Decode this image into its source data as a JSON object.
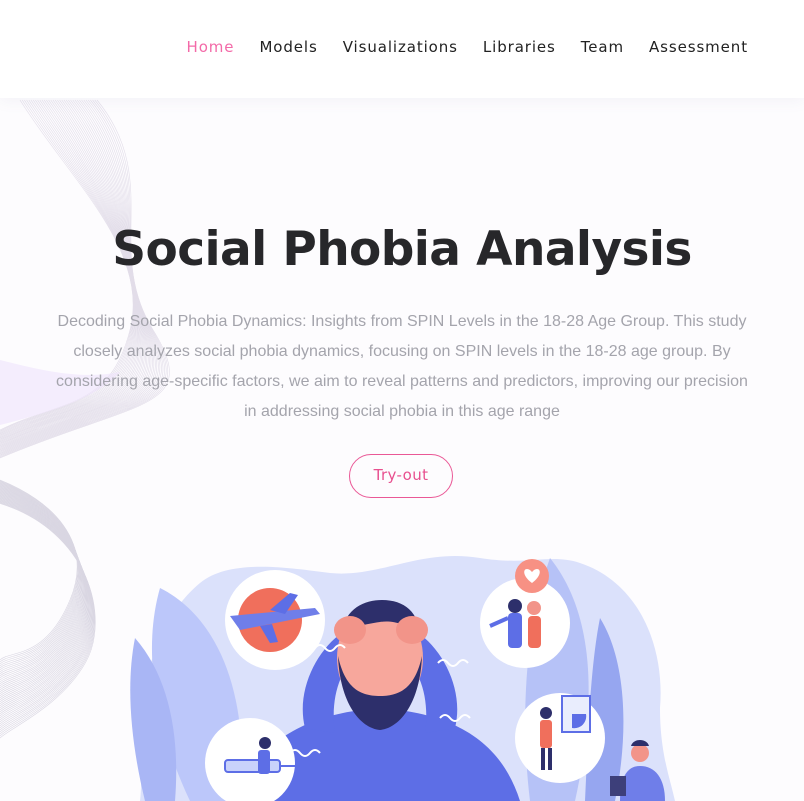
{
  "nav": {
    "items": [
      {
        "label": "Home",
        "active": true
      },
      {
        "label": "Models",
        "active": false
      },
      {
        "label": "Visualizations",
        "active": false
      },
      {
        "label": "Libraries",
        "active": false
      },
      {
        "label": "Team",
        "active": false
      },
      {
        "label": "Assessment",
        "active": false
      }
    ]
  },
  "hero": {
    "title": "Social Phobia Analysis",
    "description": "Decoding Social Phobia Dynamics: Insights from SPIN Levels in the 18-28 Age Group. This study closely analyzes social phobia dynamics, focusing on SPIN levels in the 18-28 age group. By considering age-specific factors, we aim to reveal patterns and predictors, improving our precision in addressing social phobia in this age range",
    "cta_label": "Try-out"
  },
  "colors": {
    "accent": "#f36aa8",
    "button_border": "#ea5896",
    "title": "#27272a",
    "text_muted": "#a4a4ac",
    "illustration_primary": "#6f7ee9",
    "illustration_light": "#c9d2fb"
  },
  "illustration": {
    "icons": [
      "airplane-icon",
      "couple-icon",
      "presentation-icon",
      "injection-icon",
      "heart-bubble-icon"
    ]
  }
}
